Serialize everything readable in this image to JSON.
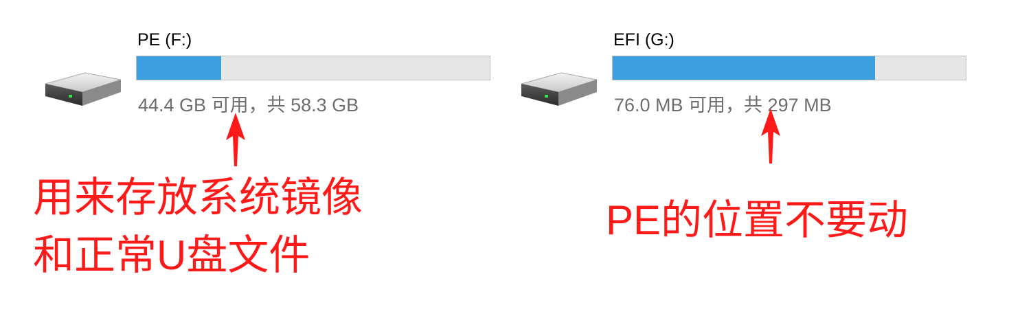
{
  "drives": [
    {
      "title": "PE (F:)",
      "space_text": "44.4 GB 可用，共 58.3 GB",
      "used_fraction": 0.239
    },
    {
      "title": "EFI (G:)",
      "space_text": "76.0 MB 可用，共 297 MB",
      "used_fraction": 0.744
    }
  ],
  "annotations": {
    "left_line1": "用来存放系统镜像",
    "left_line2": "和正常U盘文件",
    "right": "PE的位置不要动"
  },
  "colors": {
    "bar_fill": "#3c9fe0",
    "bar_track": "#e6e6e6",
    "annotation": "#ff1a1a"
  },
  "icons": [
    "drive-icon",
    "arrow-up-icon"
  ]
}
